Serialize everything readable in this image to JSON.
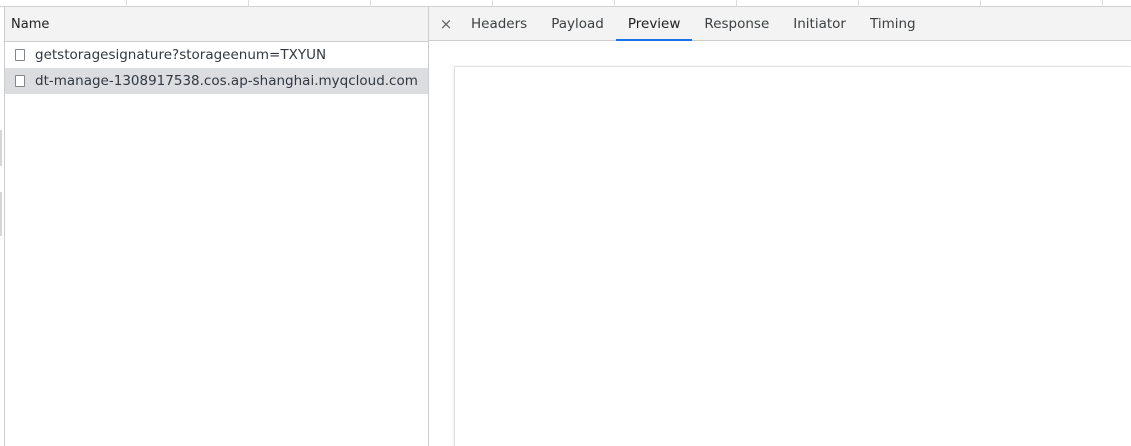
{
  "requests_panel": {
    "column_header": "Name",
    "rows": [
      {
        "name": "getstoragesignature?storageenum=TXYUN",
        "icon": "document-icon",
        "selected": false
      },
      {
        "name": "dt-manage-1308917538.cos.ap-shanghai.myqcloud.com",
        "icon": "document-icon",
        "selected": true
      }
    ]
  },
  "details_panel": {
    "close_glyph": "×",
    "tabs": [
      {
        "label": "Headers",
        "active": false
      },
      {
        "label": "Payload",
        "active": false
      },
      {
        "label": "Preview",
        "active": true
      },
      {
        "label": "Response",
        "active": false
      },
      {
        "label": "Initiator",
        "active": false
      },
      {
        "label": "Timing",
        "active": false
      }
    ]
  },
  "colors": {
    "active_tab_underline": "#1a73e8",
    "selected_row_bg": "#dcdde1",
    "header_bg": "#f3f3f3"
  }
}
